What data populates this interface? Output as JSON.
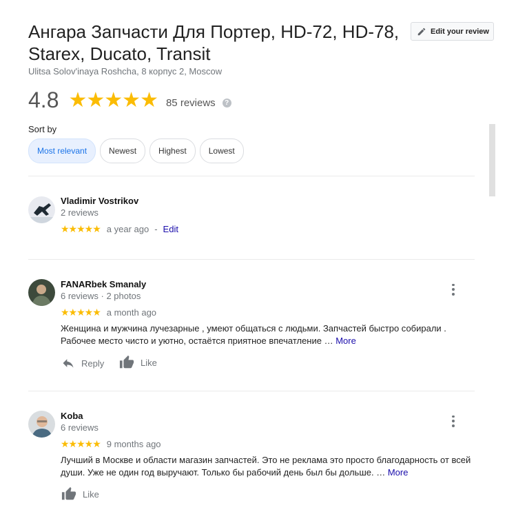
{
  "place": {
    "title": "Ангара Запчасти Для Портер, HD-72, HD-78, Starex, Ducato, Transit",
    "address": "Ulitsa Solov'inaya Roshcha, 8 корпус 2, Moscow",
    "edit_review_label": "Edit your review",
    "rating": "4.8",
    "stars": "★★★★★",
    "review_count": "85 reviews",
    "help_glyph": "?"
  },
  "sort": {
    "label": "Sort by",
    "options": [
      "Most relevant",
      "Newest",
      "Highest",
      "Lowest"
    ],
    "selected": "Most relevant"
  },
  "reviews": [
    {
      "name": "Vladimir Vostrikov",
      "meta": "2 reviews",
      "stars": "★★★★★",
      "rating": 5,
      "time": "a year ago",
      "separator": "-",
      "edit_label": "Edit"
    },
    {
      "name": "FANARbek Smanaly",
      "meta": "6 reviews · 2 photos",
      "stars": "★★★★★",
      "rating": 5,
      "time": "a month ago",
      "text": "Женщина и мужчина лучезарные , умеют общаться с людьми. Запчастей быстро собирали . Рабочее место чисто и уютно, остаётся приятное впечатление …",
      "more_label": "More",
      "reply_label": "Reply",
      "like_label": "Like"
    },
    {
      "name": "Koba",
      "meta": "6 reviews",
      "stars": "★★★★★",
      "rating": 5,
      "time": "9 months ago",
      "text": "Лучший в Москве и области магазин запчастей. Это не реклама это просто благодарность от всей души. Уже не один год выручают. Только бы рабочий день был бы дольше. …",
      "more_label": "More",
      "like_label": "Like"
    }
  ],
  "colors": {
    "star": "#fbbc04",
    "link": "#1a0dab",
    "chip_active_bg": "#e8f0fe",
    "chip_active_text": "#1a73e8"
  },
  "icons": [
    "pencil-icon",
    "help-icon",
    "more-vert-icon",
    "reply-icon",
    "thumb-up-icon"
  ]
}
